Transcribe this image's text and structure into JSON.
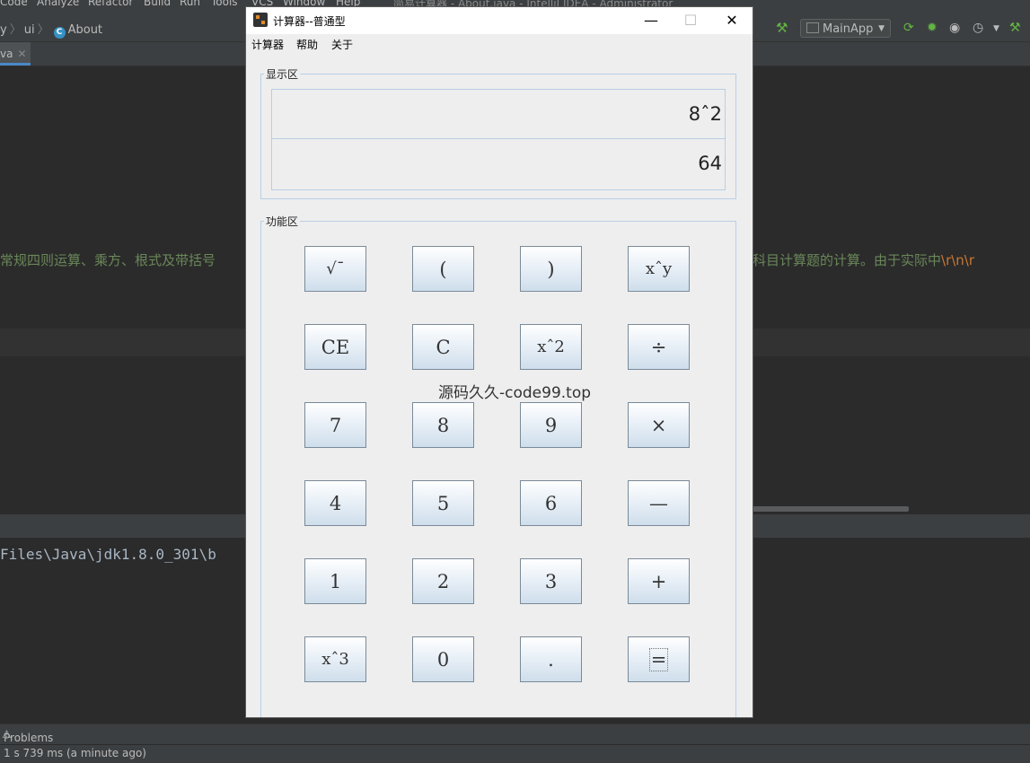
{
  "ide": {
    "menu": [
      "Code",
      "Analyze",
      "Refactor",
      "Build",
      "Run",
      "Tools",
      "VCS",
      "Window",
      "Help"
    ],
    "window_title": "简易计算器 - About.java - IntelliJ IDEA - Administrator",
    "breadcrumbs": [
      "y",
      "ui",
      "About"
    ],
    "run_config": "MainApp",
    "editor_tab": "va",
    "code_left": "常规四则运算、乘方、根式及带括号",
    "code_right": "科目计算题的计算。由于实际中",
    "code_escape": "\\r\\n\\r",
    "console_line": "Files\\Java\\jdk1.8.0_301\\b",
    "problems_label": "Problems",
    "status_text": "1 s 739 ms (a minute ago)"
  },
  "calc": {
    "title": "计算器--普通型",
    "menu": [
      "计算器",
      "帮助",
      "关于"
    ],
    "display_legend": "显示区",
    "expression": "8ˆ2",
    "result": "64",
    "function_legend": "功能区",
    "buttons": [
      [
        "√¯",
        "(",
        ")",
        "xˆy"
      ],
      [
        "CE",
        "C",
        "xˆ2",
        "÷"
      ],
      [
        "7",
        "8",
        "9",
        "×"
      ],
      [
        "4",
        "5",
        "6",
        "—"
      ],
      [
        "1",
        "2",
        "3",
        "+"
      ],
      [
        "xˆ3",
        "0",
        ".",
        "="
      ]
    ],
    "watermark": "源码久久-code99.top"
  },
  "colors": {
    "ide_bg": "#2b2b2b",
    "string_green": "#6a8759",
    "escape_orange": "#cc7832",
    "calc_border": "#b8cfe5"
  }
}
